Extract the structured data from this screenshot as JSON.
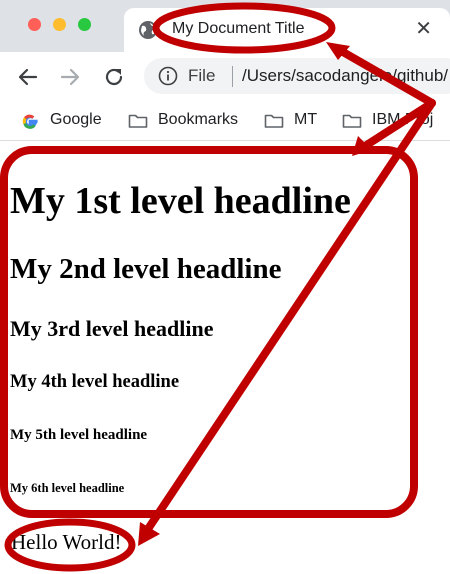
{
  "window": {
    "tab_title": "My Document Title",
    "tab_close": "✕"
  },
  "toolbar": {
    "scheme_label": "File",
    "url": "/Users/sacodangelo/github/"
  },
  "bookmarks": [
    {
      "label": "Google",
      "icon": "google-icon"
    },
    {
      "label": "Bookmarks",
      "icon": "folder-icon"
    },
    {
      "label": "MT",
      "icon": "folder-icon"
    },
    {
      "label": "IBM Proj",
      "icon": "folder-icon"
    }
  ],
  "page": {
    "h1": "My 1st level headline",
    "h2": "My 2nd level headline",
    "h3": "My 3rd level headline",
    "h4": "My 4th level headline",
    "h5": "My 5th level headline",
    "h6": "My 6th level headline",
    "paragraph": "Hello World!"
  },
  "colors": {
    "annotation": "#c00000",
    "chrome": "#dee1e6",
    "omnibox": "#f1f3f4"
  }
}
